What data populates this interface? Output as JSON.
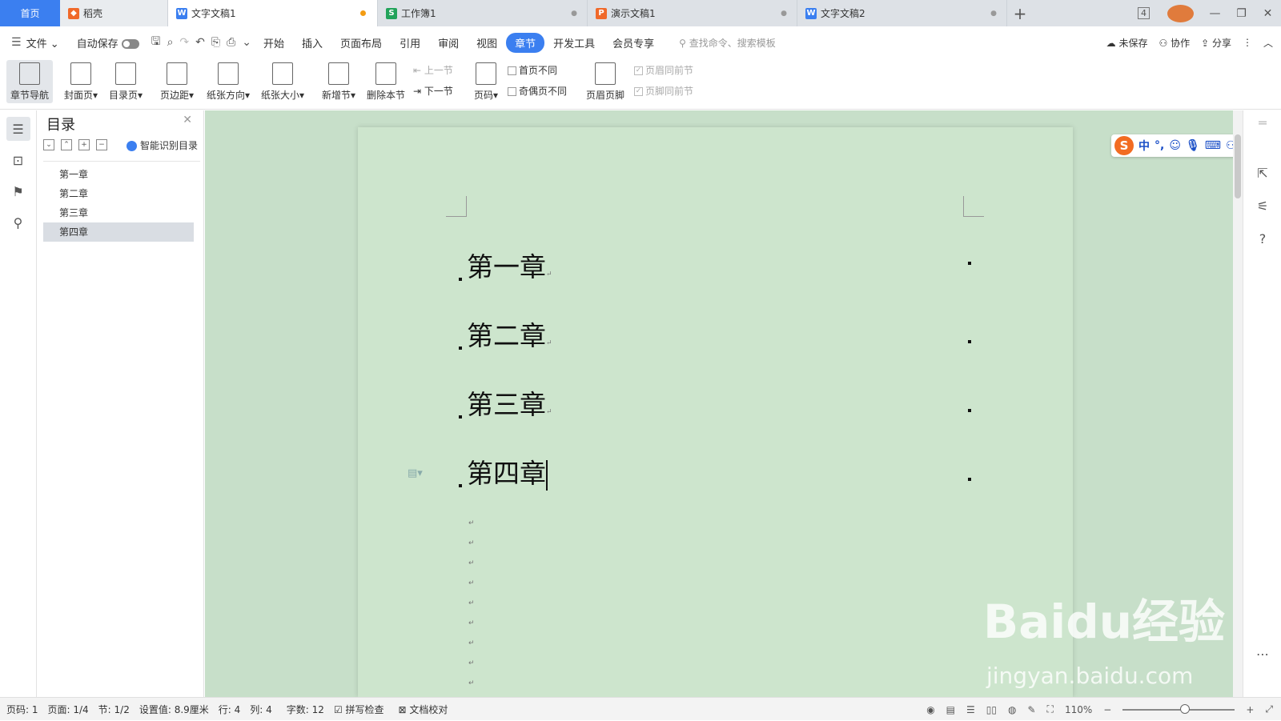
{
  "tabs": {
    "home": "首页",
    "docer": "稻壳",
    "items": [
      {
        "label": "文字文稿1",
        "icon": "W",
        "color": "#3b7ff0"
      },
      {
        "label": "工作簿1",
        "icon": "S",
        "color": "#22a35a"
      },
      {
        "label": "演示文稿1",
        "icon": "P",
        "color": "#f0692a"
      },
      {
        "label": "文字文稿2",
        "icon": "W",
        "color": "#3b7ff0"
      }
    ],
    "badge": "4"
  },
  "menu": {
    "file": "文件",
    "autosave": "自动保存",
    "items": [
      "开始",
      "插入",
      "页面布局",
      "引用",
      "审阅",
      "视图",
      "章节",
      "开发工具",
      "会员专享"
    ],
    "search_placeholder": "查找命令、搜索模板",
    "unsaved": "未保存",
    "collab": "协作",
    "share": "分享"
  },
  "ribbon": {
    "nav": "章节导航",
    "cover": "封面页",
    "toc": "目录页",
    "margin": "页边距",
    "orientation": "纸张方向",
    "size": "纸张大小",
    "add_section": "新增节",
    "delete_section": "删除本节",
    "prev_section": "上一节",
    "next_section": "下一节",
    "page_number": "页码",
    "first_page_diff": "首页不同",
    "odd_even_diff": "奇偶页不同",
    "header_footer": "页眉页脚",
    "header_same": "页眉同前节",
    "footer_same": "页脚同前节"
  },
  "toc": {
    "title": "目录",
    "smart": "智能识别目录",
    "items": [
      "第一章",
      "第二章",
      "第三章",
      "第四章"
    ]
  },
  "document": {
    "headings": [
      "第一章",
      "第二章",
      "第三章",
      "第四章"
    ]
  },
  "ime": {
    "mode": "中"
  },
  "status": {
    "page": "页码: 1",
    "pages": "页面: 1/4",
    "section": "节: 1/2",
    "setting": "设置值: 8.9厘米",
    "row": "行: 4",
    "col": "列: 4",
    "words": "字数: 12",
    "spell": "拼写检查",
    "proof": "文档校对",
    "zoom": "110%"
  },
  "watermark": {
    "main": "Baidu经验",
    "sub": "jingyan.baidu.com"
  }
}
